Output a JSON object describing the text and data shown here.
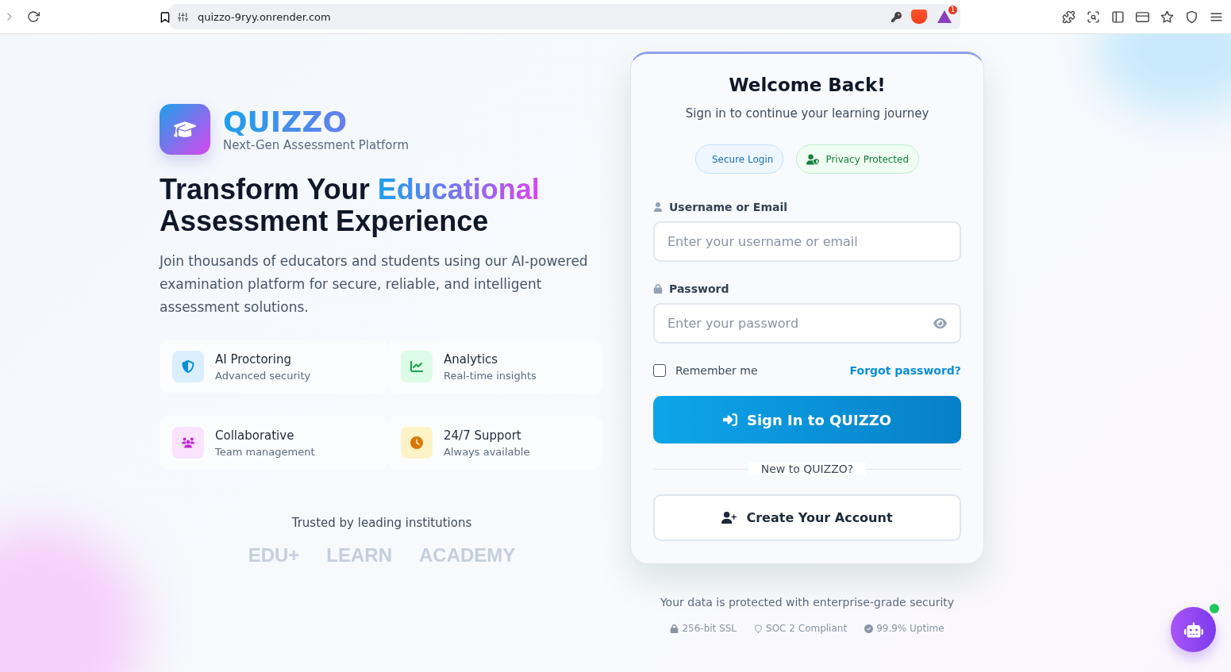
{
  "browser": {
    "url": "quizzo-9ryy.onrender.com",
    "notification_count": "1"
  },
  "brand": {
    "name": "QUIZZO",
    "tagline": "Next-Gen Assessment Platform"
  },
  "headline": {
    "before": "Transform Your ",
    "highlight": "Educational",
    "after": "Assessment Experience"
  },
  "intro": "Join thousands of educators and students using our AI-powered examination platform for secure, reliable, and intelligent assessment solutions.",
  "features": [
    {
      "kind": "shield",
      "title": "AI Proctoring",
      "subtitle": "Advanced security"
    },
    {
      "kind": "chart",
      "title": "Analytics",
      "subtitle": "Real-time insights"
    },
    {
      "kind": "team",
      "title": "Collaborative",
      "subtitle": "Team management"
    },
    {
      "kind": "clock",
      "title": "24/7 Support",
      "subtitle": "Always available"
    }
  ],
  "trusted": {
    "title": "Trusted by leading institutions",
    "logos": [
      "EDU+",
      "LEARN",
      "ACADEMY"
    ]
  },
  "login": {
    "title": "Welcome Back!",
    "subtitle": "Sign in to continue your learning journey",
    "badges": [
      {
        "kind": "secure",
        "label": "Secure Login"
      },
      {
        "kind": "privacy",
        "label": "Privacy Protected"
      }
    ],
    "username": {
      "label": "Username or Email",
      "placeholder": "Enter your username or email"
    },
    "password": {
      "label": "Password",
      "placeholder": "Enter your password"
    },
    "remember": {
      "label": "Remember me",
      "checked": false
    },
    "forgot": "Forgot password?",
    "submit": "Sign In to QUIZZO",
    "divider": "New to QUIZZO?",
    "create": "Create Your Account"
  },
  "footer": {
    "note": "Your data is protected with enterprise-grade security",
    "items": [
      {
        "kind": "lock",
        "label": "256-bit SSL"
      },
      {
        "kind": "shield",
        "label": "SOC 2 Compliant"
      },
      {
        "kind": "check",
        "label": "99.9% Uptime"
      }
    ]
  },
  "chatbot": {
    "online": true
  }
}
